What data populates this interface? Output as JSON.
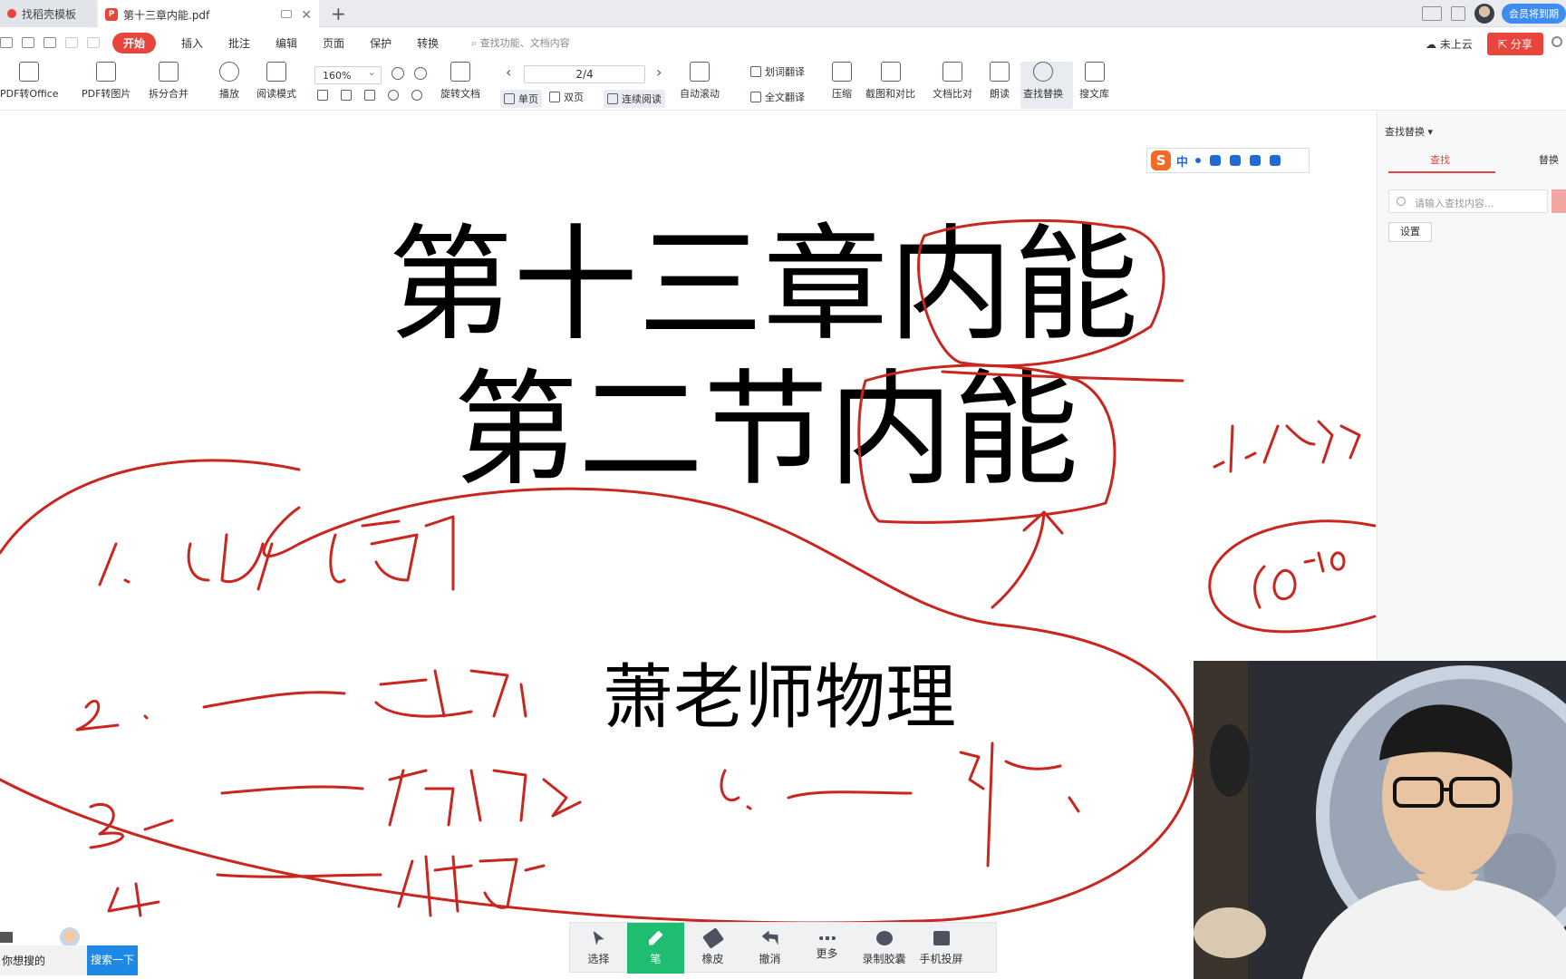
{
  "tabs": [
    {
      "label": "找稻壳模板",
      "active": false
    },
    {
      "label": "第十三章内能.pdf",
      "active": true
    }
  ],
  "top_right": {
    "vip_label": "会员将到期"
  },
  "menu": {
    "items": [
      "开始",
      "插入",
      "批注",
      "编辑",
      "页面",
      "保护",
      "转换"
    ],
    "active": "开始",
    "search_placeholder": "查找功能、文档内容",
    "cloud_status": "未上云",
    "share_label": "分享"
  },
  "toolbar": {
    "pdf_to_office": "PDF转Office",
    "pdf_to_image": "PDF转图片",
    "split_merge": "拆分合并",
    "play": "播放",
    "read_mode": "阅读模式",
    "zoom": "160%",
    "rotate": "旋转文档",
    "page_indicator": "2/4",
    "single_page": "单页",
    "double_page": "双页",
    "continuous": "连续阅读",
    "auto_scroll": "自动滚动",
    "word_translate": "划词翻译",
    "full_translate": "全文翻译",
    "compress": "压缩",
    "screenshot_compare": "截图和对比",
    "doc_compare": "文档比对",
    "read_aloud": "朗读",
    "find_replace": "查找替换",
    "search_library": "搜文库"
  },
  "right_panel": {
    "title": "查找替换",
    "tab_find": "查找",
    "tab_replace": "替换",
    "search_placeholder": "请输入查找内容...",
    "settings_label": "设置"
  },
  "ime": {
    "mode": "中"
  },
  "document": {
    "title_line1": "第十三章内能",
    "title_line2": "第二节内能",
    "author": "萧老师物理"
  },
  "pen_toolbar": {
    "items": [
      "选择",
      "笔",
      "橡皮",
      "撤消",
      "更多",
      "录制胶囊",
      "手机投屏"
    ],
    "active": "笔"
  },
  "bottom_left": {
    "input_value": "你想搜的",
    "search_button": "搜索一下"
  },
  "colors": {
    "accent_red": "#e8453c",
    "ink_red": "#c8261f",
    "pen_green": "#1fbd72",
    "search_blue": "#1e88e5"
  }
}
